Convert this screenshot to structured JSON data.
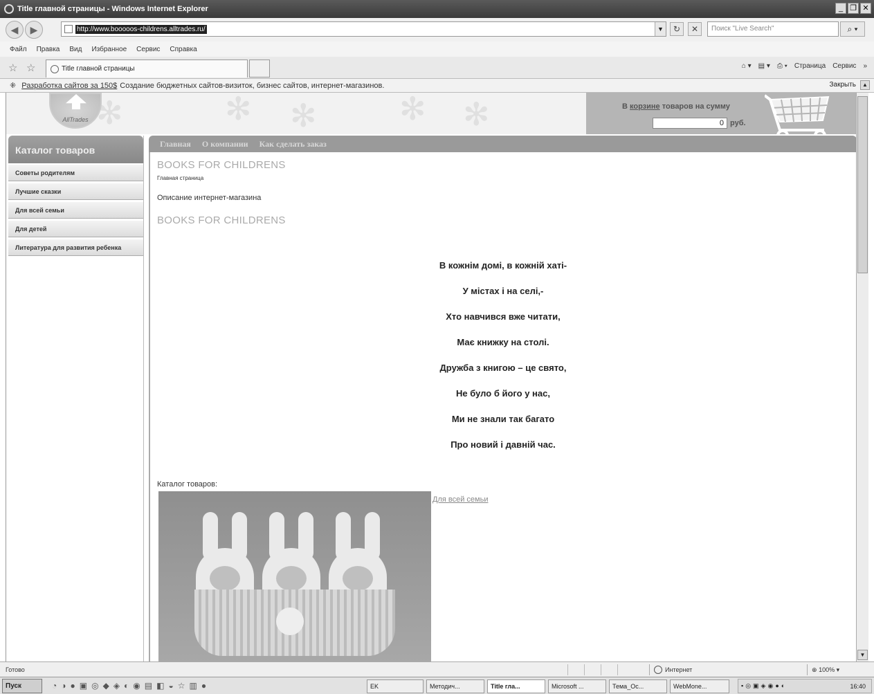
{
  "window": {
    "title": "Title главной страницы - Windows Internet Explorer",
    "controls": [
      "_",
      "❐",
      "✕"
    ]
  },
  "address_bar": {
    "url": "http://www.booooos-childrens.alltrades.ru/",
    "search_placeholder": "Поиск \"Live Search\""
  },
  "menu": [
    "Файл",
    "Правка",
    "Вид",
    "Избранное",
    "Сервис",
    "Справка"
  ],
  "tab": {
    "title": "Title главной страницы"
  },
  "command_bar": [
    "Страница",
    "Сервис"
  ],
  "info_bar": {
    "link": "Разработка сайтов за 150$",
    "text": "Создание бюджетных сайтов-визиток, бизнес сайтов, интернет-магазинов.",
    "close": "Закрыть"
  },
  "site": {
    "logo_text": "AllTrades",
    "cart": {
      "prefix": "В",
      "link": "корзине",
      "suffix": "товаров на сумму",
      "amount": "0",
      "currency": "руб."
    },
    "catalog_header": "Каталог товаров",
    "categories": [
      "Советы родителям",
      "Лучшие сказки",
      "Для всей семьи",
      "Для детей",
      "Литература для развития ребенка"
    ],
    "nav": [
      "Главная",
      "О компании",
      "Как сделать заказ"
    ],
    "page_heading": "BOOKS FOR CHILDRENS",
    "breadcrumb": "Главная страница",
    "description": "Описание интернет-магазина",
    "section_heading": "BOOKS FOR CHILDRENS",
    "poem": [
      "В кожнім домі, в кожній хаті-",
      "У містах і на селі,-",
      "Хто навчився вже читати,",
      "Має книжку на столі.",
      "Дружба з книгою – це свято,",
      "Не було б його у нас,",
      "Ми не знали так багато",
      "Про новий і давній час."
    ],
    "catalog_label": "Каталог товаров:",
    "catalog_link": "Для всей семьи"
  },
  "status_bar": {
    "status": "Готово",
    "zone": "Интернет",
    "zoom": "100%"
  },
  "taskbar": {
    "start": "Пуск",
    "buttons": [
      "EK",
      "Методич...",
      "Title гла...",
      "Microsoft ...",
      "Тема_Ос...",
      "WebMone..."
    ],
    "clock": "16:40"
  },
  "colors": {
    "nav_bar": "#9a9a9a",
    "cart_panel": "#b5b5b5",
    "heading_gray": "#aaaaaa"
  }
}
